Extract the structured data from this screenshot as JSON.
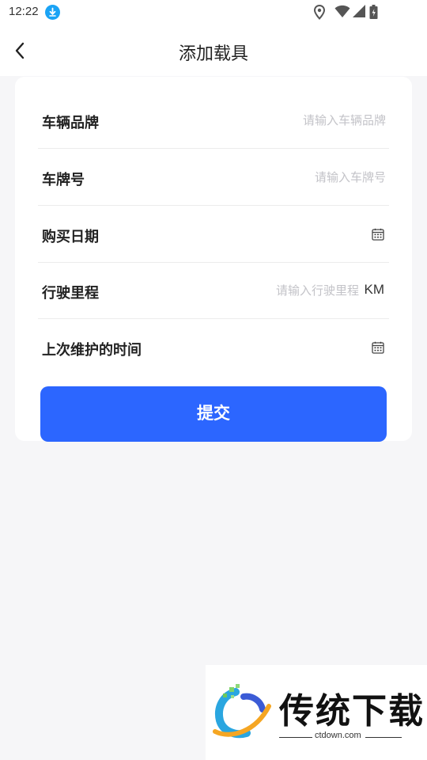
{
  "status_bar": {
    "time": "12:22",
    "icons": [
      "download-icon",
      "location-icon",
      "wifi-icon",
      "signal-icon",
      "battery-icon"
    ]
  },
  "header": {
    "title": "添加载具",
    "back_icon": "chevron-left-icon"
  },
  "form": {
    "rows": [
      {
        "label": "车辆品牌",
        "placeholder": "请输入车辆品牌",
        "value": ""
      },
      {
        "label": "车牌号",
        "placeholder": "请输入车牌号",
        "value": ""
      },
      {
        "label": "购买日期",
        "icon": "calendar-icon"
      },
      {
        "label": "行驶里程",
        "placeholder": "请输入行驶里程",
        "value": "",
        "unit": "KM"
      },
      {
        "label": "上次维护的时间",
        "icon": "calendar-icon"
      }
    ],
    "submit_label": "提交"
  },
  "watermark": {
    "brand": "传统下载",
    "domain": "ctdown.com"
  },
  "colors": {
    "accent": "#2c66ff",
    "background": "#f6f6f8",
    "card": "#ffffff",
    "placeholder": "#c3c3c8"
  }
}
